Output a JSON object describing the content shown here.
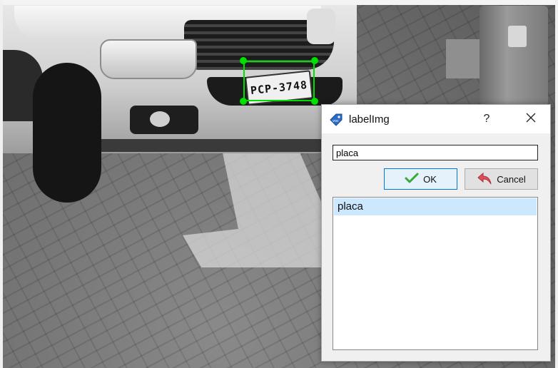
{
  "dialog": {
    "title": "labelImg",
    "help_label": "?",
    "label_input_value": "placa",
    "ok_label": "OK",
    "cancel_label": "Cancel",
    "list_items": [
      "placa"
    ],
    "selected_index": 0
  },
  "photo": {
    "plate_text": "PCP-3748"
  },
  "colors": {
    "bbox": "#00e000",
    "ok_border": "#0078d7",
    "selected_item": "#cce8ff"
  }
}
